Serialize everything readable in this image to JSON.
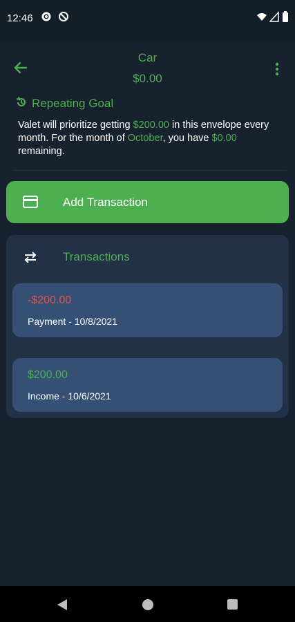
{
  "status_bar": {
    "time": "12:46",
    "icons": [
      "gear-icon",
      "no-disturb-icon",
      "wifi-icon",
      "signal-icon",
      "battery-icon"
    ]
  },
  "header": {
    "title": "Car",
    "balance": "$0.00",
    "icons": [
      "back-arrow-icon",
      "more-vert-icon"
    ]
  },
  "goal": {
    "label": "Repeating Goal",
    "icon": "history-icon",
    "text_pre": "Valet will prioritize getting ",
    "amount": "$200.00",
    "text_mid": " in this envelope every month. For the month of ",
    "month": "October",
    "text_mid2": ", you have ",
    "remaining": "$0.00",
    "text_post": " remaining."
  },
  "add_transaction": {
    "label": "Add Transaction",
    "icon": "credit-card-icon"
  },
  "transactions": {
    "title": "Transactions",
    "icon": "swap-arrows-icon",
    "items": [
      {
        "amount": "-$200.00",
        "description": "Payment - 10/8/2021",
        "type": "payment"
      },
      {
        "amount": "$200.00",
        "description": "Income - 10/6/2021",
        "type": "income"
      }
    ]
  },
  "nav_bar": {
    "icons": [
      "back-triangle-icon",
      "home-circle-icon",
      "recents-square-icon"
    ]
  },
  "colors": {
    "background": "#18222f",
    "accent": "#4caf50",
    "negative": "#e5534b",
    "panel": "#223146",
    "item": "#365075"
  }
}
